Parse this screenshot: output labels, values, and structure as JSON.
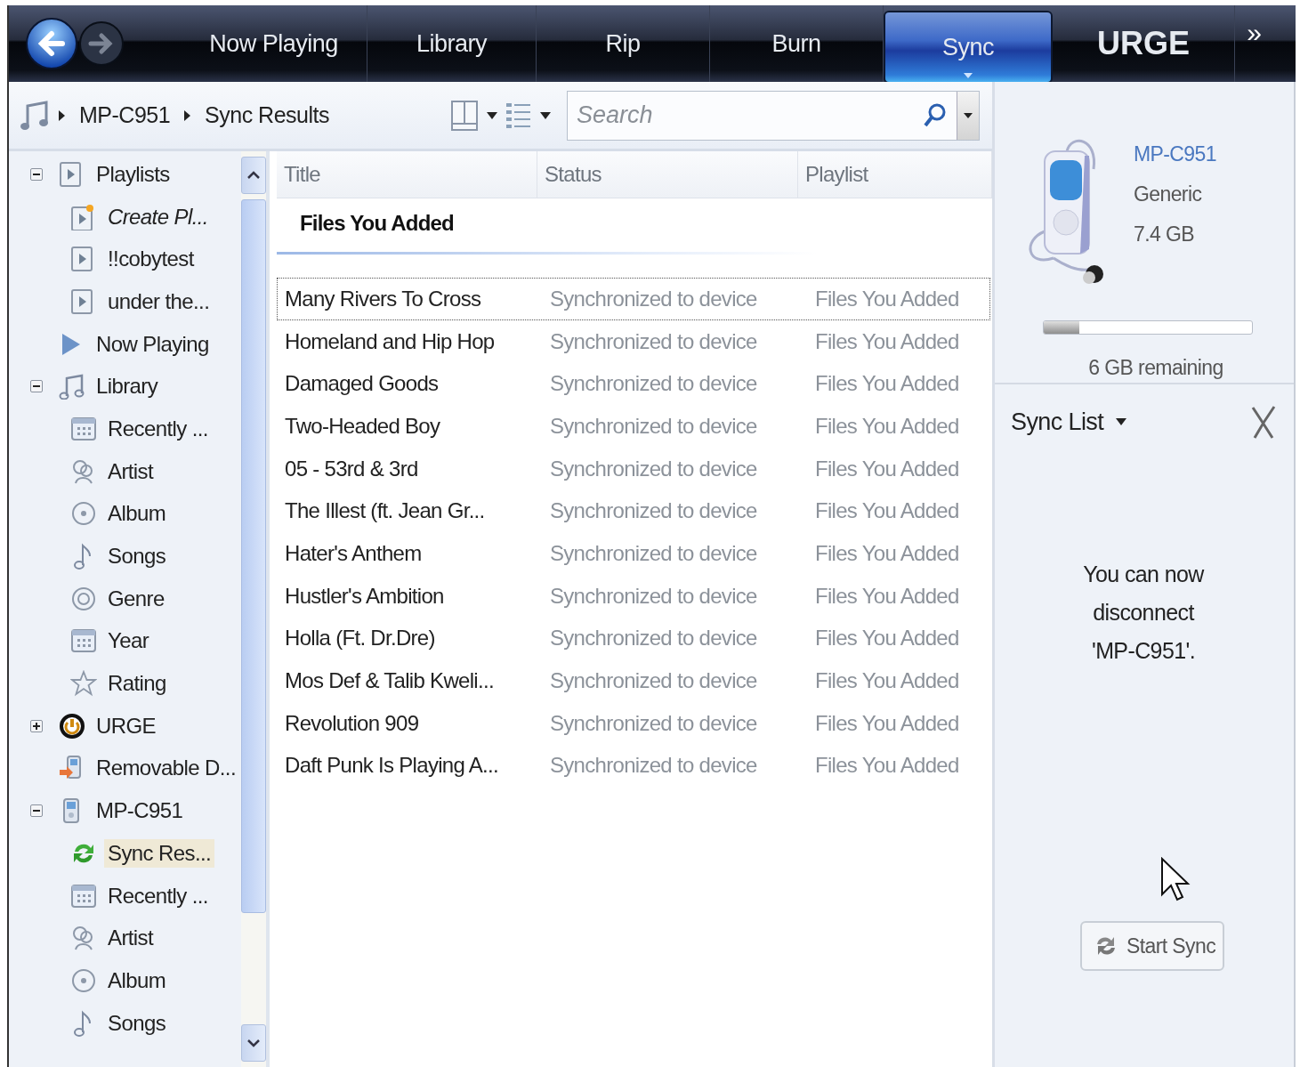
{
  "nav": {
    "tabs": [
      {
        "label": "Now Playing",
        "selected": false,
        "kind": "text"
      },
      {
        "label": "Library",
        "selected": false,
        "kind": "text"
      },
      {
        "label": "Rip",
        "selected": false,
        "kind": "text"
      },
      {
        "label": "Burn",
        "selected": false,
        "kind": "text"
      },
      {
        "label": "Sync",
        "selected": true,
        "kind": "text"
      },
      {
        "label": "URGE",
        "selected": false,
        "kind": "logo"
      }
    ],
    "more": "»"
  },
  "toolbar": {
    "breadcrumb": [
      "MP-C951",
      "Sync Results"
    ],
    "search": {
      "placeholder": "Search"
    }
  },
  "sidebar": {
    "items": [
      {
        "label": "Playlists",
        "kind": "playlist",
        "expanded": true,
        "selected": false,
        "children": [
          {
            "label": "Create Pl...",
            "kind": "create-playlist",
            "selected": false
          },
          {
            "label": "!!cobytest",
            "kind": "playlist",
            "selected": false
          },
          {
            "label": "under the...",
            "kind": "playlist",
            "selected": false
          }
        ]
      },
      {
        "label": "Now Playing",
        "kind": "now-playing",
        "selected": false
      },
      {
        "label": "Library",
        "kind": "library",
        "expanded": true,
        "selected": false,
        "children": [
          {
            "label": "Recently ...",
            "kind": "calendar",
            "selected": false
          },
          {
            "label": "Artist",
            "kind": "artist",
            "selected": false
          },
          {
            "label": "Album",
            "kind": "album",
            "selected": false
          },
          {
            "label": "Songs",
            "kind": "song",
            "selected": false
          },
          {
            "label": "Genre",
            "kind": "genre",
            "selected": false
          },
          {
            "label": "Year",
            "kind": "calendar",
            "selected": false
          },
          {
            "label": "Rating",
            "kind": "rating",
            "selected": false
          }
        ]
      },
      {
        "label": "URGE",
        "kind": "urge",
        "expanded": false,
        "selected": false
      },
      {
        "label": "Removable D...",
        "kind": "removable",
        "selected": false
      },
      {
        "label": "MP-C951",
        "kind": "device",
        "expanded": true,
        "selected": false,
        "children": [
          {
            "label": "Sync Res...",
            "kind": "sync",
            "selected": true
          },
          {
            "label": "Recently ...",
            "kind": "calendar",
            "selected": false
          },
          {
            "label": "Artist",
            "kind": "artist",
            "selected": false
          },
          {
            "label": "Album",
            "kind": "album",
            "selected": false
          },
          {
            "label": "Songs",
            "kind": "song",
            "selected": false
          }
        ]
      }
    ]
  },
  "list": {
    "columns": [
      "Title",
      "Status",
      "Playlist"
    ],
    "group": "Files You Added",
    "rows": [
      {
        "title": "Many Rivers To Cross",
        "status": "Synchronized to device",
        "playlist": "Files You Added",
        "focused": true
      },
      {
        "title": "Homeland and Hip Hop",
        "status": "Synchronized to device",
        "playlist": "Files You Added",
        "focused": false
      },
      {
        "title": "Damaged Goods",
        "status": "Synchronized to device",
        "playlist": "Files You Added",
        "focused": false
      },
      {
        "title": "Two-Headed Boy",
        "status": "Synchronized to device",
        "playlist": "Files You Added",
        "focused": false
      },
      {
        "title": "05 - 53rd & 3rd",
        "status": "Synchronized to device",
        "playlist": "Files You Added",
        "focused": false
      },
      {
        "title": "The Illest (ft. Jean Gr...",
        "status": "Synchronized to device",
        "playlist": "Files You Added",
        "focused": false
      },
      {
        "title": "Hater's Anthem",
        "status": "Synchronized to device",
        "playlist": "Files You Added",
        "focused": false
      },
      {
        "title": "Hustler's Ambition",
        "status": "Synchronized to device",
        "playlist": "Files You Added",
        "focused": false
      },
      {
        "title": "Holla (Ft. Dr.Dre)",
        "status": "Synchronized to device",
        "playlist": "Files You Added",
        "focused": false
      },
      {
        "title": "Mos Def & Talib Kweli...",
        "status": "Synchronized to device",
        "playlist": "Files You Added",
        "focused": false
      },
      {
        "title": "Revolution 909",
        "status": "Synchronized to device",
        "playlist": "Files You Added",
        "focused": false
      },
      {
        "title": "Daft Punk Is Playing A...",
        "status": "Synchronized to device",
        "playlist": "Files You Added",
        "focused": false
      }
    ]
  },
  "device": {
    "name": "MP-C951",
    "maker": "Generic",
    "capacity": "7.4 GB",
    "level": 0.17,
    "remaining": "6 GB remaining"
  },
  "sync_list": {
    "title": "Sync List",
    "message": "You can now disconnect 'MP-C951'.",
    "button": "Start Sync"
  }
}
